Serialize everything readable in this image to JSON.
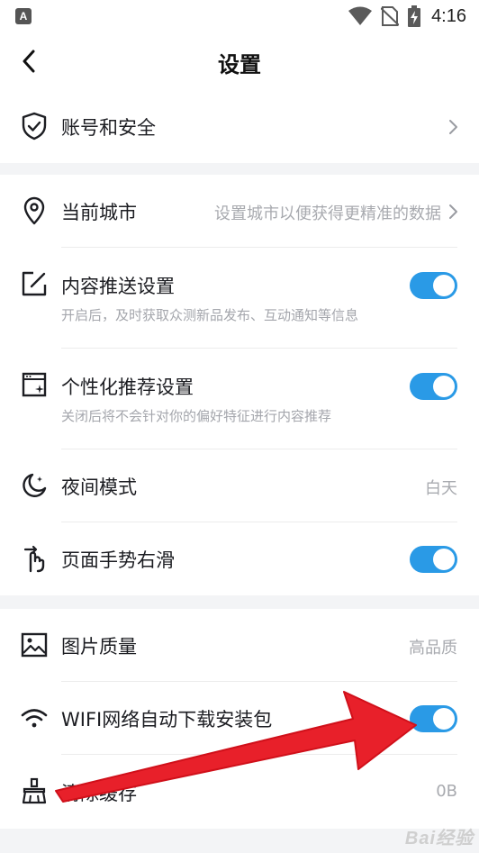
{
  "status_bar": {
    "notif_icon": "a-letter-icon",
    "notif_letter": "A",
    "icons": [
      "wifi-icon",
      "no-sim-icon",
      "battery-charging-icon"
    ],
    "time": "4:16"
  },
  "nav": {
    "back_icon": "chevron-left-icon",
    "title": "设置"
  },
  "sections": [
    {
      "items": [
        {
          "icon": "shield-check-icon",
          "title": "账号和安全",
          "control": "chevron"
        }
      ]
    },
    {
      "items": [
        {
          "icon": "location-pin-icon",
          "title": "当前城市",
          "value": "设置城市以便获得更精准的数据",
          "control": "chevron"
        },
        {
          "icon": "edit-square-icon",
          "title": "内容推送设置",
          "subtitle": "开启后，及时获取众测新品发布、互动通知等信息",
          "control": "toggle",
          "on": true
        },
        {
          "icon": "window-sparkle-icon",
          "title": "个性化推荐设置",
          "subtitle": "关闭后将不会针对你的偏好特征进行内容推荐",
          "control": "toggle",
          "on": true
        },
        {
          "icon": "moon-icon",
          "title": "夜间模式",
          "value": "白天"
        },
        {
          "icon": "swipe-hand-icon",
          "title": "页面手势右滑",
          "control": "toggle",
          "on": true
        }
      ]
    },
    {
      "items": [
        {
          "icon": "image-icon",
          "title": "图片质量",
          "value": "高品质"
        },
        {
          "icon": "wifi-icon",
          "title": "WIFI网络自动下载安装包",
          "control": "toggle",
          "on": true
        },
        {
          "icon": "broom-icon",
          "title": "清除缓存",
          "value": "0B"
        }
      ]
    }
  ],
  "colors": {
    "toggle_on": "#2a9ae6",
    "arrow": "#e8202a",
    "page_bg": "#f3f4f6"
  },
  "annotation": {
    "type": "red-arrow",
    "points_to": "WIFI网络自动下载安装包 toggle"
  },
  "watermark": "Bai经验"
}
